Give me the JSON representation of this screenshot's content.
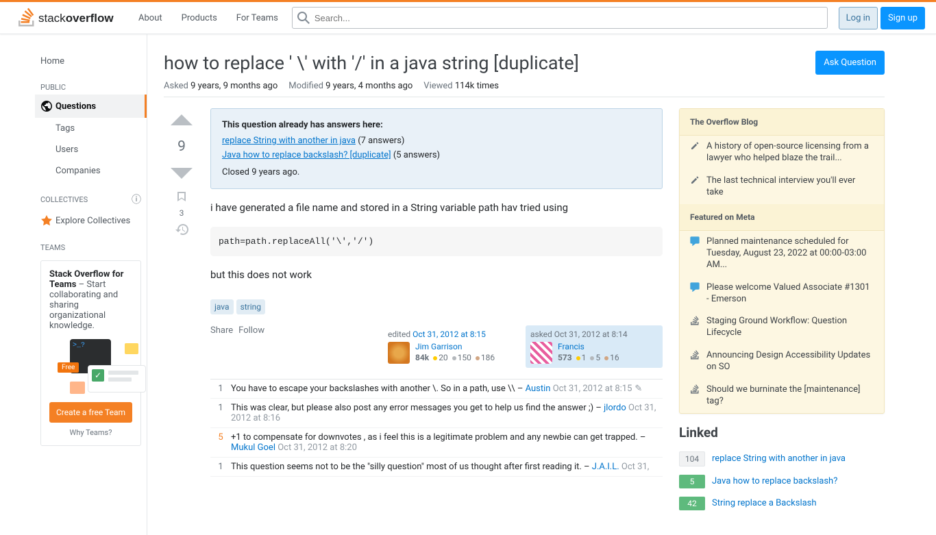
{
  "header": {
    "nav": {
      "about": "About",
      "products": "Products",
      "teams": "For Teams"
    },
    "search_placeholder": "Search...",
    "login": "Log in",
    "signup": "Sign up"
  },
  "sidebar": {
    "home": "Home",
    "public_heading": "PUBLIC",
    "questions": "Questions",
    "tags": "Tags",
    "users": "Users",
    "companies": "Companies",
    "collectives_heading": "COLLECTIVES",
    "explore_collectives": "Explore Collectives",
    "teams_heading": "TEAMS",
    "teams_box": {
      "title": "Stack Overflow for Teams",
      "desc": " – Start collaborating and sharing organizational knowledge.",
      "free": "Free",
      "prompt": ">_?",
      "create": "Create a free Team",
      "why": "Why Teams?"
    }
  },
  "question": {
    "title": "how to replace ' \\' with '/' in a java string [duplicate]",
    "ask_button": "Ask Question",
    "asked_label": "Asked",
    "asked_value": "9 years, 9 months ago",
    "modified_label": "Modified",
    "modified_value": "9 years, 4 months ago",
    "viewed_label": "Viewed",
    "viewed_value": "114k times",
    "vote_count": "9",
    "bookmark_count": "3",
    "notice": {
      "heading": "This question already has answers here:",
      "dup1": "replace String with another in java",
      "dup1_count": " (7 answers)",
      "dup2": "Java how to replace backslash? [duplicate]",
      "dup2_count": " (5 answers)",
      "closed": "Closed 9 years ago."
    },
    "body": {
      "p1": "i have generated a file name and stored in a String variable path hav tried using",
      "code": "path=path.replaceAll('\\','/')",
      "p2": "but this does not work"
    },
    "tags": {
      "t1": "java",
      "t2": "string"
    },
    "actions": {
      "share": "Share",
      "follow": "Follow"
    },
    "editor": {
      "action": "edited ",
      "date": "Oct 31, 2012 at 8:15",
      "name": "Jim Garrison",
      "rep": "84k",
      "gold": "20",
      "silver": "150",
      "bronze": "186"
    },
    "author": {
      "action": "asked ",
      "date": "Oct 31, 2012 at 8:14",
      "name": "Francis",
      "rep": "573",
      "gold": "1",
      "silver": "5",
      "bronze": "16"
    },
    "comments": [
      {
        "score": "1",
        "hot": false,
        "text": "You have to escape your backslashes with another \\. So in a path, use \\\\ – ",
        "user": "Austin",
        "date": "Oct 31, 2012 at 8:15",
        "edited": true
      },
      {
        "score": "1",
        "hot": false,
        "text": "This was clear, but please also post any error messages you get to help us find the answer ;) – ",
        "user": "jlordo",
        "date": "Oct 31, 2012 at 8:16",
        "edited": false
      },
      {
        "score": "5",
        "hot": true,
        "text": "+1 to compensate for downvotes , as i feel this is a legitimate problem and any newbie can get trapped. – ",
        "user": "Mukul Goel",
        "date": "Oct 31, 2012 at 8:20",
        "edited": false
      },
      {
        "score": "1",
        "hot": false,
        "text": "This question seems not to be the \"silly question\" most of us thought after first reading it. – ",
        "user": "J.A.I.L.",
        "date": "Oct 31,",
        "edited": false
      }
    ]
  },
  "widget": {
    "blog_title": "The Overflow Blog",
    "blog1": "A history of open-source licensing from a lawyer who helped blaze the trail...",
    "blog2": "The last technical interview you'll ever take",
    "meta_title": "Featured on Meta",
    "meta1": "Planned maintenance scheduled for Tuesday, August 23, 2022 at 00:00-03:00 AM...",
    "meta2": "Please welcome Valued Associate #1301 - Emerson",
    "meta3": "Staging Ground Workflow: Question Lifecycle",
    "meta4": "Announcing Design Accessibility Updates on SO",
    "meta5": "Should we burninate the [maintenance] tag?"
  },
  "linked": {
    "title": "Linked",
    "items": [
      {
        "score": "104",
        "answered": false,
        "title": "replace String with another in java"
      },
      {
        "score": "5",
        "answered": true,
        "title": "Java how to replace backslash?"
      },
      {
        "score": "42",
        "answered": true,
        "title": "String replace a Backslash"
      }
    ]
  }
}
